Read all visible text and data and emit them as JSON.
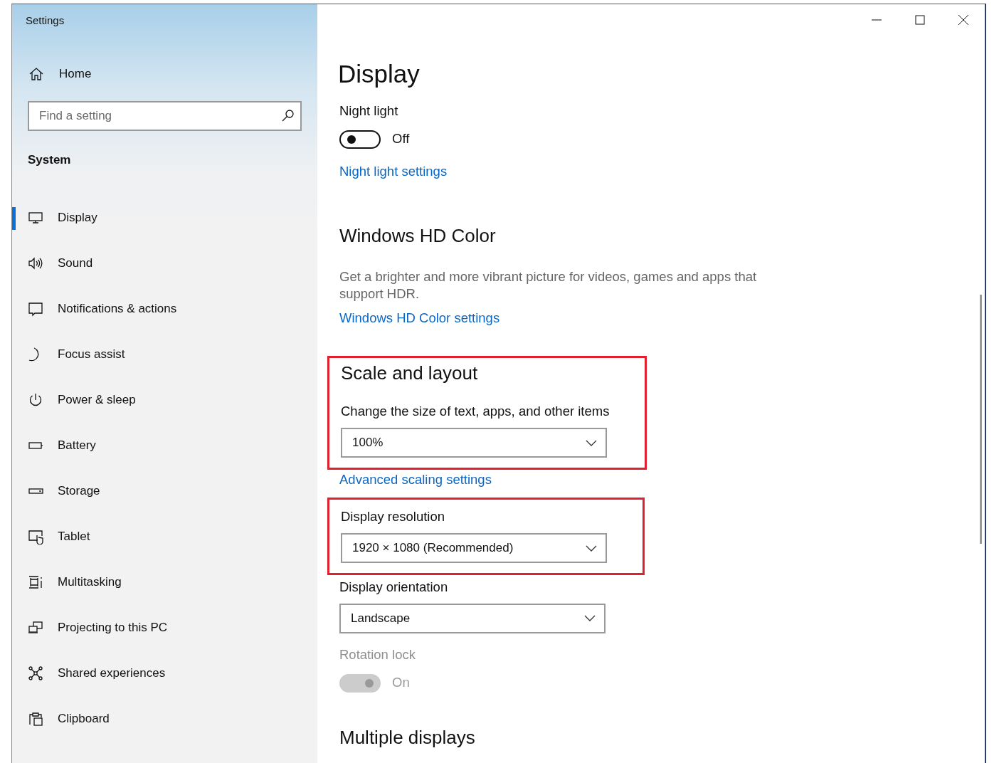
{
  "window": {
    "title": "Settings"
  },
  "sidebar": {
    "home": {
      "label": "Home"
    },
    "search": {
      "placeholder": "Find a setting"
    },
    "group_title": "System",
    "items": [
      {
        "label": "Display",
        "selected": true
      },
      {
        "label": "Sound",
        "selected": false
      },
      {
        "label": "Notifications & actions",
        "selected": false
      },
      {
        "label": "Focus assist",
        "selected": false
      },
      {
        "label": "Power & sleep",
        "selected": false
      },
      {
        "label": "Battery",
        "selected": false
      },
      {
        "label": "Storage",
        "selected": false
      },
      {
        "label": "Tablet",
        "selected": false
      },
      {
        "label": "Multitasking",
        "selected": false
      },
      {
        "label": "Projecting to this PC",
        "selected": false
      },
      {
        "label": "Shared experiences",
        "selected": false
      },
      {
        "label": "Clipboard",
        "selected": false
      }
    ]
  },
  "main": {
    "title": "Display",
    "blocks": [
      {
        "kind": "label",
        "text": "Night light",
        "disabled": false
      },
      {
        "kind": "toggle",
        "on": false,
        "disabled": false,
        "state_text": "Off"
      },
      {
        "kind": "link",
        "text": "Night light settings"
      },
      {
        "kind": "heading",
        "text": "Windows HD Color"
      },
      {
        "kind": "paragraph",
        "text": "Get a brighter and more vibrant picture for videos, games and apps that support HDR."
      },
      {
        "kind": "link",
        "text": "Windows HD Color settings"
      },
      {
        "kind": "group",
        "highlighted": true,
        "children": [
          {
            "kind": "heading",
            "text": "Scale and layout"
          },
          {
            "kind": "label",
            "text": "Change the size of text, apps, and other items",
            "disabled": false
          },
          {
            "kind": "dropdown",
            "value": "100%"
          }
        ]
      },
      {
        "kind": "link",
        "text": "Advanced scaling settings"
      },
      {
        "kind": "group",
        "highlighted": true,
        "children": [
          {
            "kind": "label",
            "text": "Display resolution",
            "disabled": false
          },
          {
            "kind": "dropdown",
            "value": "1920 × 1080 (Recommended)"
          }
        ]
      },
      {
        "kind": "label",
        "text": "Display orientation",
        "disabled": false
      },
      {
        "kind": "dropdown",
        "value": "Landscape"
      },
      {
        "kind": "label",
        "text": "Rotation lock",
        "disabled": true
      },
      {
        "kind": "toggle",
        "on": true,
        "disabled": true,
        "state_text": "On"
      },
      {
        "kind": "heading",
        "text": "Multiple displays"
      }
    ]
  }
}
